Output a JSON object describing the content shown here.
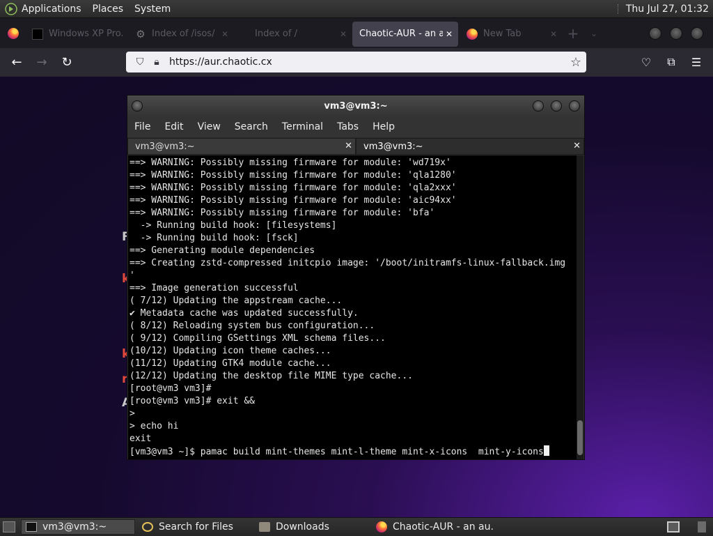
{
  "top_panel": {
    "menus": [
      "Applications",
      "Places",
      "System"
    ],
    "clock": "Thu Jul 27, 01:32"
  },
  "browser": {
    "tabs": [
      {
        "title": "Windows XP Pro...",
        "icon": "black-square-icon",
        "active": false
      },
      {
        "title": "Index of /isos/",
        "icon": "gear-icon",
        "active": false
      },
      {
        "title": "Index of /",
        "icon": "",
        "active": false
      },
      {
        "title": "Chaotic-AUR - an au",
        "icon": "",
        "active": true
      },
      {
        "title": "New Tab",
        "icon": "firefox-icon",
        "active": false
      }
    ],
    "url": "https://aur.chaotic.cx"
  },
  "terminal": {
    "window_title": "vm3@vm3:~",
    "menu": [
      "File",
      "Edit",
      "View",
      "Search",
      "Terminal",
      "Tabs",
      "Help"
    ],
    "tabs": [
      "vm3@vm3:~",
      "vm3@vm3:~"
    ],
    "lines": [
      "==> WARNING: Possibly missing firmware for module: 'wd719x'",
      "==> WARNING: Possibly missing firmware for module: 'qla1280'",
      "==> WARNING: Possibly missing firmware for module: 'qla2xxx'",
      "==> WARNING: Possibly missing firmware for module: 'aic94xx'",
      "==> WARNING: Possibly missing firmware for module: 'bfa'",
      "  -> Running build hook: [filesystems]",
      "  -> Running build hook: [fsck]",
      "==> Generating module dependencies",
      "==> Creating zstd-compressed initcpio image: '/boot/initramfs-linux-fallback.img",
      "'",
      "==> Image generation successful",
      "( 7/12) Updating the appstream cache...",
      "✔ Metadata cache was updated successfully.",
      "( 8/12) Reloading system bus configuration...",
      "( 9/12) Compiling GSettings XML schema files...",
      "(10/12) Updating icon theme caches...",
      "(11/12) Updating GTK4 module cache...",
      "(12/12) Updating the desktop file MIME type cache...",
      "[root@vm3 vm3]#",
      "[root@vm3 vm3]# exit &&",
      ">",
      "> echo hi",
      "exit"
    ],
    "prompt_line": "[vm3@vm3 ~]$ pamac build mint-themes mint-l-theme mint-x-icons  mint-y-icons"
  },
  "taskbar": {
    "tasks": [
      {
        "label": "vm3@vm3:~",
        "active": true
      },
      {
        "label": "Search for Files",
        "active": false
      },
      {
        "label": "Downloads",
        "active": false
      },
      {
        "label": "Chaotic-AUR - an au...",
        "active": false
      }
    ]
  }
}
